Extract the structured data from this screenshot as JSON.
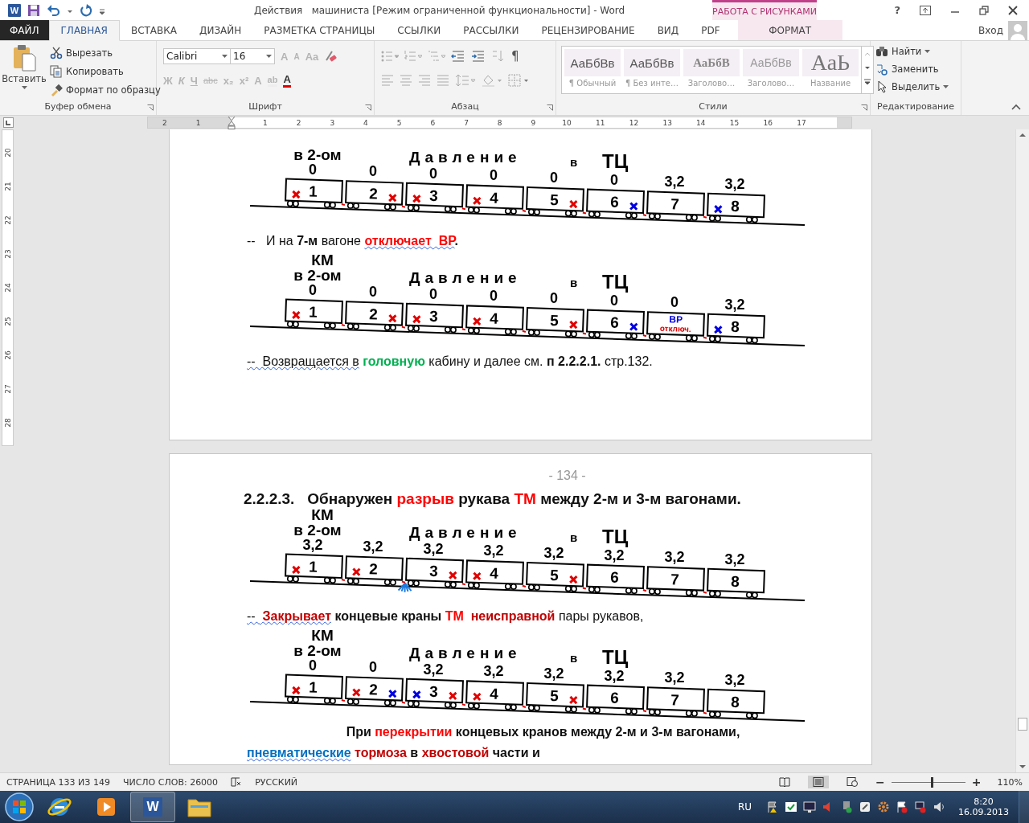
{
  "app": {
    "logo_letter": "W"
  },
  "window": {
    "title": "Действия   машиниста [Режим ограниченной функциональности] - Word",
    "context_header": "РАБОТА С РИСУНКАМИ",
    "help": "?",
    "sign_in": "Вход"
  },
  "tabs": [
    {
      "label": "ФАЙЛ",
      "kind": "file",
      "selected": false
    },
    {
      "label": "ГЛАВНАЯ",
      "kind": "normal",
      "selected": true
    },
    {
      "label": "ВСТАВКА",
      "kind": "normal",
      "selected": false
    },
    {
      "label": "ДИЗАЙН",
      "kind": "normal",
      "selected": false
    },
    {
      "label": "РАЗМЕТКА СТРАНИЦЫ",
      "kind": "normal",
      "selected": false
    },
    {
      "label": "ССЫЛКИ",
      "kind": "normal",
      "selected": false
    },
    {
      "label": "РАССЫЛКИ",
      "kind": "normal",
      "selected": false
    },
    {
      "label": "РЕЦЕНЗИРОВАНИЕ",
      "kind": "normal",
      "selected": false
    },
    {
      "label": "ВИД",
      "kind": "normal",
      "selected": false
    },
    {
      "label": "PDF",
      "kind": "normal",
      "selected": false
    },
    {
      "label": "ФОРМАТ",
      "kind": "contextual",
      "selected": false
    }
  ],
  "clipboard": {
    "paste": "Вставить",
    "cut": "Вырезать",
    "copy": "Копировать",
    "format_painter": "Формат по образцу",
    "group": "Буфер обмена"
  },
  "font": {
    "name": "Calibri",
    "size": "16",
    "group": "Шрифт",
    "top_buttons": [
      {
        "label": "A",
        "kind": "grow",
        "disabled": true
      },
      {
        "label": "A",
        "kind": "shrink",
        "disabled": true
      },
      {
        "label": "Aa",
        "kind": "case",
        "disabled": true
      }
    ],
    "bottom_buttons": [
      {
        "label": "Ж",
        "kind": "bold",
        "disabled": true
      },
      {
        "label": "К",
        "kind": "italic",
        "disabled": true
      },
      {
        "label": "Ч",
        "kind": "underline",
        "disabled": true
      },
      {
        "label": "abc",
        "kind": "strike",
        "disabled": true
      },
      {
        "label": "x₂",
        "kind": "sub",
        "disabled": true
      },
      {
        "label": "x²",
        "kind": "sup",
        "disabled": true
      },
      {
        "label": "A",
        "kind": "effects",
        "disabled": true
      },
      {
        "label": "ab",
        "kind": "highlight",
        "disabled": true
      },
      {
        "label": "A",
        "kind": "color",
        "disabled": false
      }
    ]
  },
  "paragraph": {
    "group": "Абзац",
    "pilcrow": "¶"
  },
  "styles": {
    "group": "Стили",
    "items": [
      {
        "preview": "АаБбВв",
        "label": "¶ Обычный",
        "kind": "normal"
      },
      {
        "preview": "АаБбВв",
        "label": "¶ Без инте…",
        "kind": "normal"
      },
      {
        "preview": "АаБбВ",
        "label": "Заголово…",
        "kind": "heading1"
      },
      {
        "preview": "АаБбВв",
        "label": "Заголово…",
        "kind": "heading2"
      },
      {
        "preview": "АаЬ",
        "label": "Название",
        "kind": "title"
      }
    ]
  },
  "editing": {
    "group": "Редактирование",
    "find": "Найти",
    "replace": "Заменить",
    "select": "Выделить"
  },
  "ruler": {
    "horizontal": [
      "2",
      "1",
      "1",
      "2",
      "3",
      "4",
      "5",
      "6",
      "7",
      "8",
      "9",
      "10",
      "11",
      "12",
      "13",
      "14",
      "15",
      "16",
      "17"
    ],
    "vertical": [
      "20",
      "21",
      "22",
      "23",
      "24",
      "25",
      "26",
      "27",
      "28"
    ]
  },
  "pages": [
    {
      "blocks": [
        {
          "kind": "diagram",
          "position_label": "в 2-ом",
          "title_word": "Давление",
          "title_in": "в",
          "title_unit": "ТЦ",
          "cars": [
            {
              "number": "1",
              "pressure": "0",
              "left_mark": {
                "color": "#e00000"
              },
              "hose_break": false
            },
            {
              "number": "2",
              "pressure": "0",
              "right_mark": {
                "color": "#e00000"
              },
              "hose_break": false
            },
            {
              "number": "3",
              "pressure": "0",
              "left_mark": {
                "color": "#e00000"
              },
              "hose_break": false
            },
            {
              "number": "4",
              "pressure": "0",
              "left_mark": {
                "color": "#e00000"
              },
              "hose_break": false
            },
            {
              "number": "5",
              "pressure": "0",
              "right_mark": {
                "color": "#e00000"
              },
              "hose_break": false
            },
            {
              "number": "6",
              "pressure": "0",
              "right_mark": {
                "color": "#0000e0"
              },
              "hose_break": false
            },
            {
              "number": "7",
              "pressure": "3,2",
              "hose_break": false
            },
            {
              "number": "8",
              "pressure": "3,2",
              "left_mark": {
                "color": "#0000e0"
              },
              "hose_break": false
            }
          ]
        },
        {
          "kind": "paragraph",
          "centered": false,
          "segments": [
            {
              "text": "--   И на ",
              "kind": "plain",
              "spell": false
            },
            {
              "text": "7-м",
              "kind": "bold",
              "spell": false
            },
            {
              "text": " вагоне ",
              "kind": "plain",
              "spell": false
            },
            {
              "text": "отключает  ВР",
              "kind": "red",
              "spell": true
            },
            {
              "text": ".",
              "kind": "bold",
              "spell": false
            }
          ]
        },
        {
          "kind": "diagram",
          "km_label": "КМ",
          "position_label": "в 2-ом",
          "title_word": "Давление",
          "title_in": "в",
          "title_unit": "ТЦ",
          "cars": [
            {
              "number": "1",
              "pressure": "0",
              "left_mark": {
                "color": "#e00000"
              },
              "hose_break": false
            },
            {
              "number": "2",
              "pressure": "0",
              "right_mark": {
                "color": "#e00000"
              },
              "hose_break": false
            },
            {
              "number": "3",
              "pressure": "0",
              "left_mark": {
                "color": "#e00000"
              },
              "hose_break": false
            },
            {
              "number": "4",
              "pressure": "0",
              "left_mark": {
                "color": "#e00000"
              },
              "hose_break": false
            },
            {
              "number": "5",
              "pressure": "0",
              "right_mark": {
                "color": "#e00000"
              },
              "hose_break": false
            },
            {
              "number": "6",
              "pressure": "0",
              "right_mark": {
                "color": "#0000e0"
              },
              "hose_break": false
            },
            {
              "pressure": "0",
              "note_top": "ВР",
              "note_bottom": "отключ.",
              "hose_break": false
            },
            {
              "number": "8",
              "pressure": "3,2",
              "left_mark": {
                "color": "#0000e0"
              },
              "hose_break": false
            }
          ]
        },
        {
          "kind": "paragraph",
          "centered": false,
          "segments": [
            {
              "text": "--  Возвращается в",
              "kind": "plain",
              "spell": true
            },
            {
              "text": " головную",
              "kind": "green",
              "spell": false
            },
            {
              "text": " кабину и далее см. ",
              "kind": "plain",
              "spell": false
            },
            {
              "text": "п 2.2.2.1.",
              "kind": "bold",
              "spell": false
            },
            {
              "text": " стр.132.",
              "kind": "plain",
              "spell": false
            }
          ]
        }
      ]
    },
    {
      "page_number": "- 134 -",
      "blocks": [
        {
          "kind": "heading",
          "centered": false,
          "segments": [
            {
              "text": "2.2.2.3.   Обнаружен ",
              "kind": "bold",
              "spell": false
            },
            {
              "text": "разрыв",
              "kind": "red",
              "spell": false
            },
            {
              "text": " рукава ",
              "kind": "bold",
              "spell": false
            },
            {
              "text": "ТМ",
              "kind": "red",
              "spell": false
            },
            {
              "text": " между 2-м и 3-м вагонами.",
              "kind": "bold",
              "spell": false
            }
          ]
        },
        {
          "kind": "diagram",
          "km_label": "КМ",
          "position_label": "в 2-ом",
          "title_word": "Давление",
          "title_in": "в",
          "title_unit": "ТЦ",
          "cars": [
            {
              "number": "1",
              "pressure": "3,2",
              "left_mark": {
                "color": "#e00000"
              },
              "hose_break": false
            },
            {
              "number": "2",
              "pressure": "3,2",
              "left_mark": {
                "color": "#e00000"
              },
              "hose_break": true
            },
            {
              "number": "3",
              "pressure": "3,2",
              "right_mark": {
                "color": "#e00000"
              },
              "hose_break": false
            },
            {
              "number": "4",
              "pressure": "3,2",
              "left_mark": {
                "color": "#e00000"
              },
              "hose_break": false
            },
            {
              "number": "5",
              "pressure": "3,2",
              "right_mark": {
                "color": "#e00000"
              },
              "hose_break": false
            },
            {
              "number": "6",
              "pressure": "3,2",
              "hose_break": false
            },
            {
              "number": "7",
              "pressure": "3,2",
              "hose_break": false
            },
            {
              "number": "8",
              "pressure": "3,2",
              "hose_break": false
            }
          ]
        },
        {
          "kind": "paragraph",
          "centered": false,
          "segments": [
            {
              "text": "-- ",
              "kind": "plain",
              "spell": true
            },
            {
              "text": " Закрывает",
              "kind": "darkred",
              "spell": true
            },
            {
              "text": " концевые краны ",
              "kind": "bold",
              "spell": false
            },
            {
              "text": "ТМ",
              "kind": "red",
              "spell": false
            },
            {
              "text": "  неисправной",
              "kind": "darkred",
              "spell": false
            },
            {
              "text": " пары рукавов,",
              "kind": "plain",
              "spell": false
            }
          ]
        },
        {
          "kind": "diagram",
          "km_label": "КМ",
          "position_label": "в 2-ом",
          "title_word": "Давление",
          "title_in": "в",
          "title_unit": "ТЦ",
          "cars": [
            {
              "number": "1",
              "pressure": "0",
              "left_mark": {
                "color": "#e00000"
              },
              "hose_break": false
            },
            {
              "number": "2",
              "pressure": "0",
              "left_mark": {
                "color": "#e00000"
              },
              "right_mark": {
                "color": "#0000e0"
              },
              "hose_break": false
            },
            {
              "number": "3",
              "pressure": "3,2",
              "left_mark": {
                "color": "#0000e0"
              },
              "right_mark": {
                "color": "#e00000"
              },
              "hose_break": false
            },
            {
              "number": "4",
              "pressure": "3,2",
              "left_mark": {
                "color": "#e00000"
              },
              "hose_break": false
            },
            {
              "number": "5",
              "pressure": "3,2",
              "right_mark": {
                "color": "#e00000"
              },
              "hose_break": false
            },
            {
              "number": "6",
              "pressure": "3,2",
              "hose_break": false
            },
            {
              "number": "7",
              "pressure": "3,2",
              "hose_break": false
            },
            {
              "number": "8",
              "pressure": "3,2",
              "hose_break": false
            }
          ]
        },
        {
          "kind": "paragraph",
          "centered": true,
          "segments": [
            {
              "text": "При ",
              "kind": "bold",
              "spell": false
            },
            {
              "text": "перекрытии",
              "kind": "red",
              "spell": false
            },
            {
              "text": " концевых кранов между 2-м и 3-м вагонами,",
              "kind": "bold",
              "spell": false
            }
          ]
        },
        {
          "kind": "paragraph",
          "centered": false,
          "segments": [
            {
              "text": "пневматические",
              "kind": "blue",
              "spell": true
            },
            {
              "text": " тормоза",
              "kind": "darkred",
              "spell": false
            },
            {
              "text": " в ",
              "kind": "bold",
              "spell": false
            },
            {
              "text": "хвостовой",
              "kind": "darkred",
              "spell": false
            },
            {
              "text": " части и",
              "kind": "bold",
              "spell": false
            }
          ]
        }
      ]
    }
  ],
  "status_bar": {
    "page": "СТРАНИЦА 133 ИЗ 149",
    "words": "ЧИСЛО СЛОВ: 26000",
    "language": "РУССКИЙ",
    "views": [
      {
        "kind": "read",
        "selected": false
      },
      {
        "kind": "print",
        "selected": true
      },
      {
        "kind": "web",
        "selected": false
      }
    ],
    "zoom_out": "−",
    "zoom_in": "+",
    "zoom": {
      "level": 0.55
    },
    "zoom_label": "110%"
  },
  "taskbar": {
    "pins": [
      {
        "kind": "ie",
        "selected": false
      },
      {
        "kind": "media",
        "selected": false
      },
      {
        "kind": "word",
        "selected": true,
        "letter": "W"
      },
      {
        "kind": "explorer",
        "selected": false
      }
    ],
    "language": "RU",
    "time": "8:20",
    "date": "16.09.2013"
  }
}
